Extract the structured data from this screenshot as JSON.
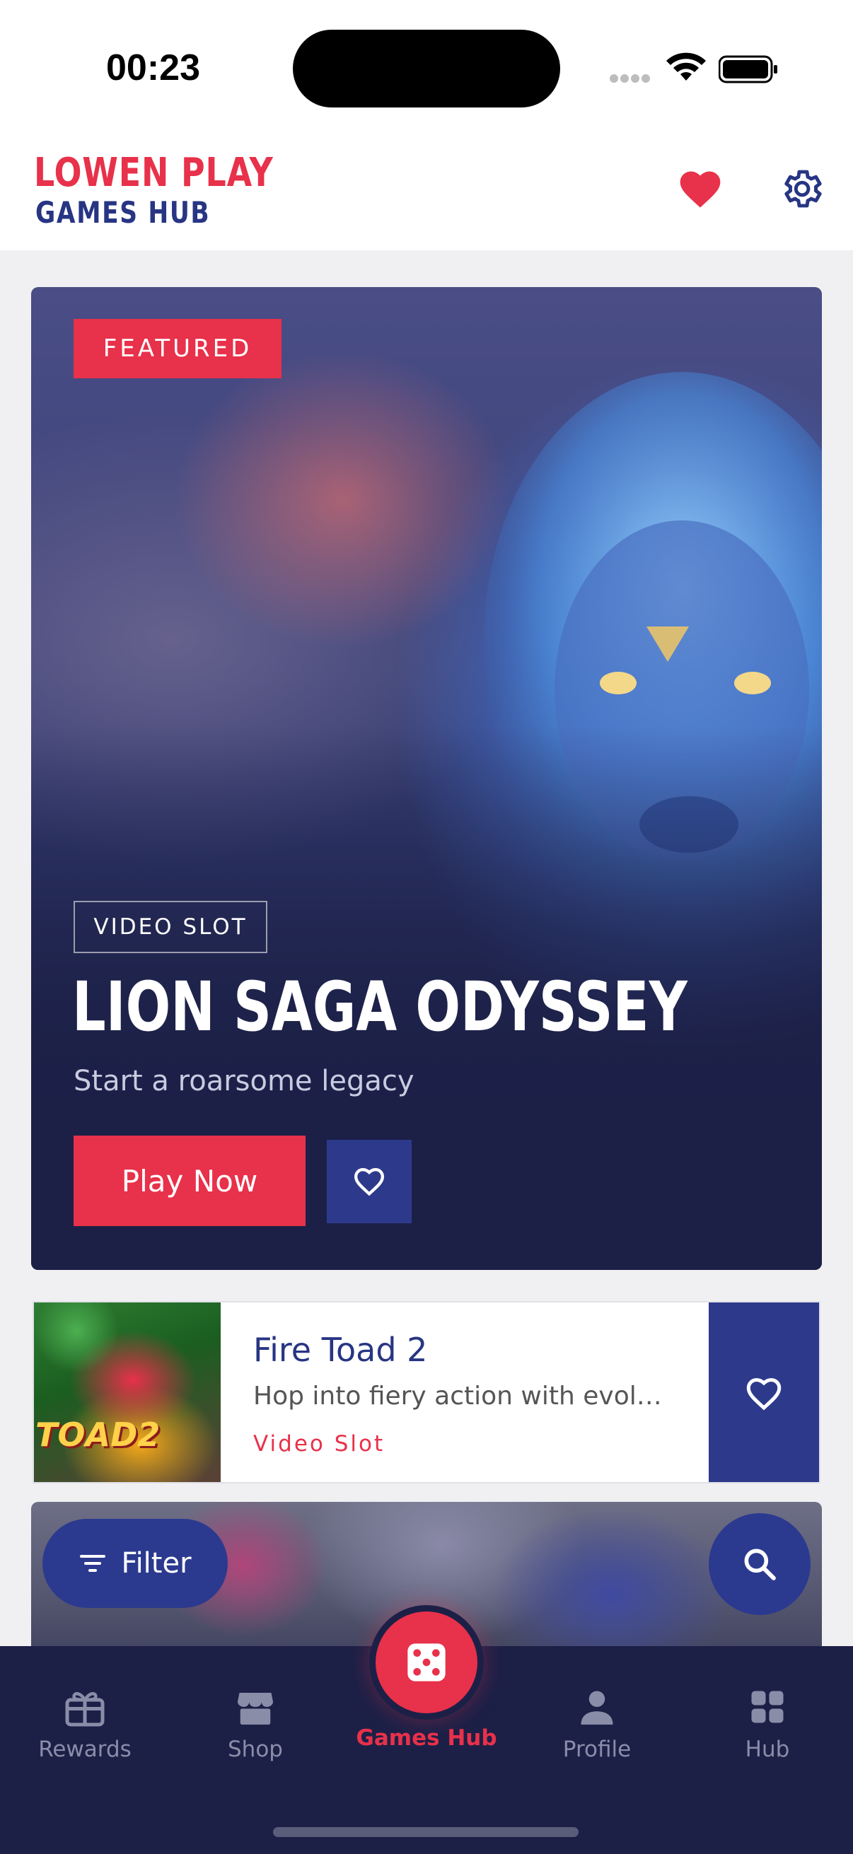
{
  "status_bar": {
    "time": "00:23"
  },
  "header": {
    "brand_top": "LOWEN PLAY",
    "brand_bottom": "GAMES HUB"
  },
  "featured": {
    "badge": "FEATURED",
    "type": "VIDEO SLOT",
    "title": "LION SAGA ODYSSEY",
    "subtitle": "Start a roarsome legacy",
    "play_label": "Play Now"
  },
  "game_row": {
    "title": "Fire Toad 2",
    "description": "Hop into fiery action with evolving features",
    "type": "Video Slot",
    "thumb_text": "TOAD2"
  },
  "filter": {
    "label": "Filter"
  },
  "nav": {
    "items": [
      {
        "label": "Rewards",
        "icon": "gift-icon"
      },
      {
        "label": "Shop",
        "icon": "shop-icon"
      },
      {
        "label": "Games Hub",
        "icon": "dice-icon"
      },
      {
        "label": "Profile",
        "icon": "person-icon"
      },
      {
        "label": "Hub",
        "icon": "grid-icon"
      }
    ],
    "active_index": 2
  },
  "colors": {
    "accent": "#e8314a",
    "navy": "#273583",
    "nav_bg": "#1c2047"
  }
}
